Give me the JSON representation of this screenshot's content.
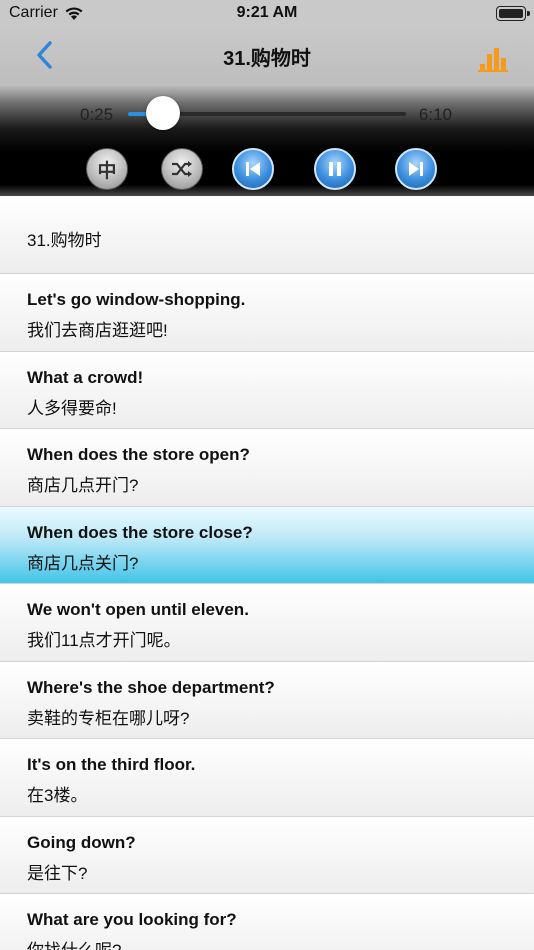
{
  "status": {
    "carrier": "Carrier",
    "time": "9:21 AM"
  },
  "nav": {
    "title": "31.购物时",
    "back_icon": "chevron-left-icon",
    "stats_icon": "bar-chart-icon",
    "accent_color": "#f59a1b",
    "back_color": "#2f86d9"
  },
  "player": {
    "current_time": "0:25",
    "total_time": "6:10",
    "progress": 0.068,
    "lang_button_label": "中",
    "shuffle_icon": "shuffle-icon",
    "prev_icon": "skip-previous-icon",
    "pause_icon": "pause-icon",
    "next_icon": "skip-next-icon"
  },
  "list": {
    "header": "31.购物时",
    "active_index": 3,
    "items": [
      {
        "en": "Let's go window-shopping.",
        "zh": "我们去商店逛逛吧!"
      },
      {
        "en": "What a crowd!",
        "zh": "人多得要命!"
      },
      {
        "en": "When does the store open?",
        "zh": "商店几点开门?"
      },
      {
        "en": "When does the store close?",
        "zh": "商店几点关门?"
      },
      {
        "en": "We won't open until eleven.",
        "zh": "我们11点才开门呢。"
      },
      {
        "en": "Where's the shoe department?",
        "zh": "卖鞋的专柜在哪儿呀?"
      },
      {
        "en": "It's on the third floor.",
        "zh": "在3楼。"
      },
      {
        "en": "Going down?",
        "zh": "是往下?"
      },
      {
        "en": "What are you looking for?",
        "zh": "你找什么呢?"
      }
    ]
  }
}
